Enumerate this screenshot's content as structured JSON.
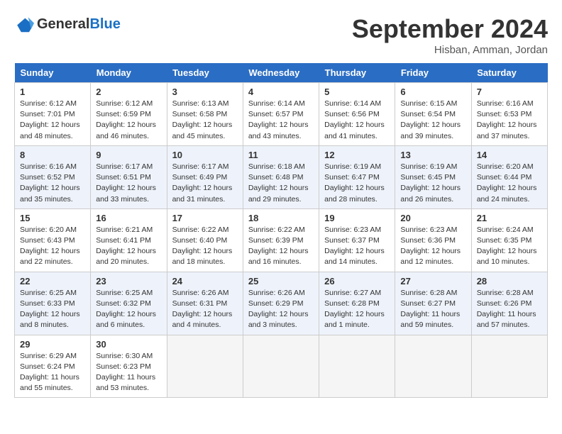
{
  "header": {
    "logo_general": "General",
    "logo_blue": "Blue",
    "month_title": "September 2024",
    "location": "Hisban, Amman, Jordan"
  },
  "days_of_week": [
    "Sunday",
    "Monday",
    "Tuesday",
    "Wednesday",
    "Thursday",
    "Friday",
    "Saturday"
  ],
  "weeks": [
    [
      {
        "day": "1",
        "lines": [
          "Sunrise: 6:12 AM",
          "Sunset: 7:01 PM",
          "Daylight: 12 hours",
          "and 48 minutes."
        ]
      },
      {
        "day": "2",
        "lines": [
          "Sunrise: 6:12 AM",
          "Sunset: 6:59 PM",
          "Daylight: 12 hours",
          "and 46 minutes."
        ]
      },
      {
        "day": "3",
        "lines": [
          "Sunrise: 6:13 AM",
          "Sunset: 6:58 PM",
          "Daylight: 12 hours",
          "and 45 minutes."
        ]
      },
      {
        "day": "4",
        "lines": [
          "Sunrise: 6:14 AM",
          "Sunset: 6:57 PM",
          "Daylight: 12 hours",
          "and 43 minutes."
        ]
      },
      {
        "day": "5",
        "lines": [
          "Sunrise: 6:14 AM",
          "Sunset: 6:56 PM",
          "Daylight: 12 hours",
          "and 41 minutes."
        ]
      },
      {
        "day": "6",
        "lines": [
          "Sunrise: 6:15 AM",
          "Sunset: 6:54 PM",
          "Daylight: 12 hours",
          "and 39 minutes."
        ]
      },
      {
        "day": "7",
        "lines": [
          "Sunrise: 6:16 AM",
          "Sunset: 6:53 PM",
          "Daylight: 12 hours",
          "and 37 minutes."
        ]
      }
    ],
    [
      {
        "day": "8",
        "lines": [
          "Sunrise: 6:16 AM",
          "Sunset: 6:52 PM",
          "Daylight: 12 hours",
          "and 35 minutes."
        ]
      },
      {
        "day": "9",
        "lines": [
          "Sunrise: 6:17 AM",
          "Sunset: 6:51 PM",
          "Daylight: 12 hours",
          "and 33 minutes."
        ]
      },
      {
        "day": "10",
        "lines": [
          "Sunrise: 6:17 AM",
          "Sunset: 6:49 PM",
          "Daylight: 12 hours",
          "and 31 minutes."
        ]
      },
      {
        "day": "11",
        "lines": [
          "Sunrise: 6:18 AM",
          "Sunset: 6:48 PM",
          "Daylight: 12 hours",
          "and 29 minutes."
        ]
      },
      {
        "day": "12",
        "lines": [
          "Sunrise: 6:19 AM",
          "Sunset: 6:47 PM",
          "Daylight: 12 hours",
          "and 28 minutes."
        ]
      },
      {
        "day": "13",
        "lines": [
          "Sunrise: 6:19 AM",
          "Sunset: 6:45 PM",
          "Daylight: 12 hours",
          "and 26 minutes."
        ]
      },
      {
        "day": "14",
        "lines": [
          "Sunrise: 6:20 AM",
          "Sunset: 6:44 PM",
          "Daylight: 12 hours",
          "and 24 minutes."
        ]
      }
    ],
    [
      {
        "day": "15",
        "lines": [
          "Sunrise: 6:20 AM",
          "Sunset: 6:43 PM",
          "Daylight: 12 hours",
          "and 22 minutes."
        ]
      },
      {
        "day": "16",
        "lines": [
          "Sunrise: 6:21 AM",
          "Sunset: 6:41 PM",
          "Daylight: 12 hours",
          "and 20 minutes."
        ]
      },
      {
        "day": "17",
        "lines": [
          "Sunrise: 6:22 AM",
          "Sunset: 6:40 PM",
          "Daylight: 12 hours",
          "and 18 minutes."
        ]
      },
      {
        "day": "18",
        "lines": [
          "Sunrise: 6:22 AM",
          "Sunset: 6:39 PM",
          "Daylight: 12 hours",
          "and 16 minutes."
        ]
      },
      {
        "day": "19",
        "lines": [
          "Sunrise: 6:23 AM",
          "Sunset: 6:37 PM",
          "Daylight: 12 hours",
          "and 14 minutes."
        ]
      },
      {
        "day": "20",
        "lines": [
          "Sunrise: 6:23 AM",
          "Sunset: 6:36 PM",
          "Daylight: 12 hours",
          "and 12 minutes."
        ]
      },
      {
        "day": "21",
        "lines": [
          "Sunrise: 6:24 AM",
          "Sunset: 6:35 PM",
          "Daylight: 12 hours",
          "and 10 minutes."
        ]
      }
    ],
    [
      {
        "day": "22",
        "lines": [
          "Sunrise: 6:25 AM",
          "Sunset: 6:33 PM",
          "Daylight: 12 hours",
          "and 8 minutes."
        ]
      },
      {
        "day": "23",
        "lines": [
          "Sunrise: 6:25 AM",
          "Sunset: 6:32 PM",
          "Daylight: 12 hours",
          "and 6 minutes."
        ]
      },
      {
        "day": "24",
        "lines": [
          "Sunrise: 6:26 AM",
          "Sunset: 6:31 PM",
          "Daylight: 12 hours",
          "and 4 minutes."
        ]
      },
      {
        "day": "25",
        "lines": [
          "Sunrise: 6:26 AM",
          "Sunset: 6:29 PM",
          "Daylight: 12 hours",
          "and 3 minutes."
        ]
      },
      {
        "day": "26",
        "lines": [
          "Sunrise: 6:27 AM",
          "Sunset: 6:28 PM",
          "Daylight: 12 hours",
          "and 1 minute."
        ]
      },
      {
        "day": "27",
        "lines": [
          "Sunrise: 6:28 AM",
          "Sunset: 6:27 PM",
          "Daylight: 11 hours",
          "and 59 minutes."
        ]
      },
      {
        "day": "28",
        "lines": [
          "Sunrise: 6:28 AM",
          "Sunset: 6:26 PM",
          "Daylight: 11 hours",
          "and 57 minutes."
        ]
      }
    ],
    [
      {
        "day": "29",
        "lines": [
          "Sunrise: 6:29 AM",
          "Sunset: 6:24 PM",
          "Daylight: 11 hours",
          "and 55 minutes."
        ]
      },
      {
        "day": "30",
        "lines": [
          "Sunrise: 6:30 AM",
          "Sunset: 6:23 PM",
          "Daylight: 11 hours",
          "and 53 minutes."
        ]
      },
      null,
      null,
      null,
      null,
      null
    ]
  ]
}
